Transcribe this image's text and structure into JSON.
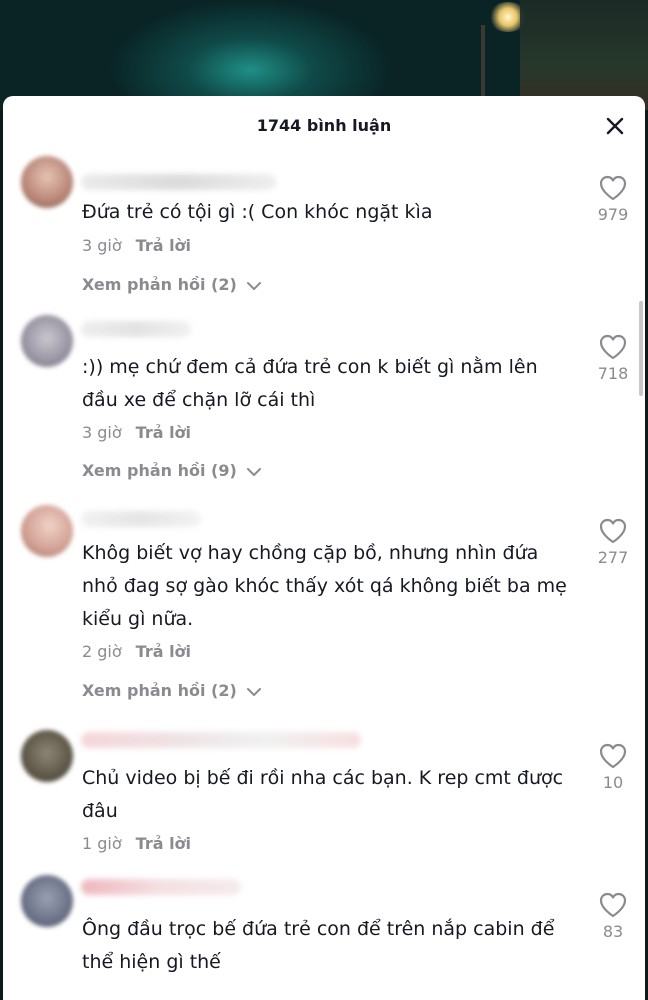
{
  "header": {
    "title": "1744 bình luận"
  },
  "comments": [
    {
      "text": "Đứa trẻ có tội gì :( Con khóc ngặt kìa",
      "time": "3 giờ",
      "reply": "Trả lời",
      "view_replies": "Xem phản hồi (2)",
      "likes": "979"
    },
    {
      "text": ":)) mẹ chứ đem cả đứa trẻ con k biết gì nằm lên đầu xe để chặn lỡ cái thì",
      "time": "3 giờ",
      "reply": "Trả lời",
      "view_replies": "Xem phản hồi (9)",
      "likes": "718"
    },
    {
      "text": "Khôg biết vợ hay chồng cặp bồ, nhưng nhìn đứa nhỏ đag sợ gào khóc thấy xót qá không biết ba mẹ kiểu gì nữa.",
      "time": "2 giờ",
      "reply": "Trả lời",
      "view_replies": "Xem phản hồi (2)",
      "likes": "277"
    },
    {
      "text": "Chủ video bị bế đi rồi nha các bạn. K rep cmt được đâu",
      "time": "1 giờ",
      "reply": "Trả lời",
      "likes": "10"
    },
    {
      "text": "Ông đầu trọc bế đứa trẻ con để trên nắp cabin để thể hiện gì thế",
      "likes": "83"
    }
  ],
  "colors": {
    "text_primary": "#161823",
    "text_secondary": "#8a8b91",
    "sheet_background": "#ffffff"
  },
  "icons": {
    "close": "close-icon",
    "like": "heart-outline-icon",
    "expand": "chevron-down-icon"
  }
}
